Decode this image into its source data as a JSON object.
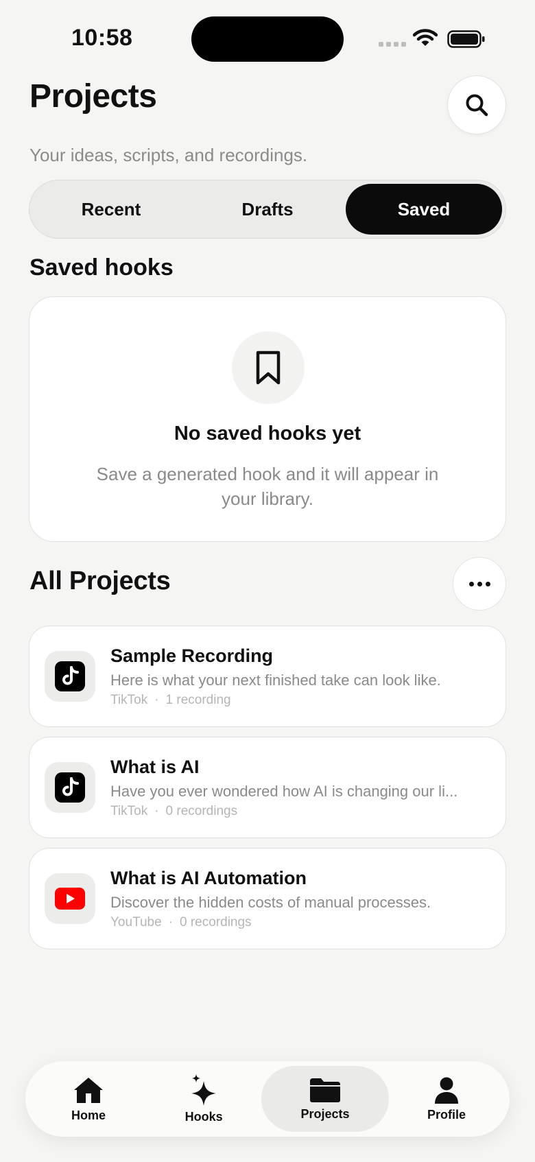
{
  "status_bar": {
    "time": "10:58"
  },
  "header": {
    "title": "Projects",
    "subtitle": "Your ideas, scripts, and recordings.",
    "search_icon": "search-icon"
  },
  "segments": [
    {
      "label": "Recent",
      "active": false
    },
    {
      "label": "Drafts",
      "active": false
    },
    {
      "label": "Saved",
      "active": true
    }
  ],
  "saved_hooks": {
    "title": "Saved hooks",
    "empty_icon": "bookmark-icon",
    "empty_title": "No saved hooks yet",
    "empty_description": "Save a generated hook and it will appear in your library."
  },
  "all_projects": {
    "title": "All Projects",
    "more_icon": "more-horizontal-icon",
    "items": [
      {
        "title": "Sample Recording",
        "description": "Here is what your next finished take can look like.",
        "platform": "TikTok",
        "separator": "·",
        "recordings": "1 recording",
        "icon": "tiktok-icon"
      },
      {
        "title": "What is AI",
        "description": "Have you ever wondered how AI is changing our li...",
        "platform": "TikTok",
        "separator": "·",
        "recordings": "0 recordings",
        "icon": "tiktok-icon"
      },
      {
        "title": "What is AI Automation",
        "description": "Discover the hidden costs of manual processes.",
        "platform": "YouTube",
        "separator": "·",
        "recordings": "0 recordings",
        "icon": "youtube-icon"
      }
    ]
  },
  "tabbar": [
    {
      "label": "Home",
      "icon": "home-icon",
      "active": false
    },
    {
      "label": "Hooks",
      "icon": "sparkle-icon",
      "active": false
    },
    {
      "label": "Projects",
      "icon": "folder-icon",
      "active": true
    },
    {
      "label": "Profile",
      "icon": "person-icon",
      "active": false
    }
  ],
  "colors": {
    "accent": "#0b0b0b",
    "background": "#f5f5f3",
    "youtube_red": "#ff0000"
  }
}
